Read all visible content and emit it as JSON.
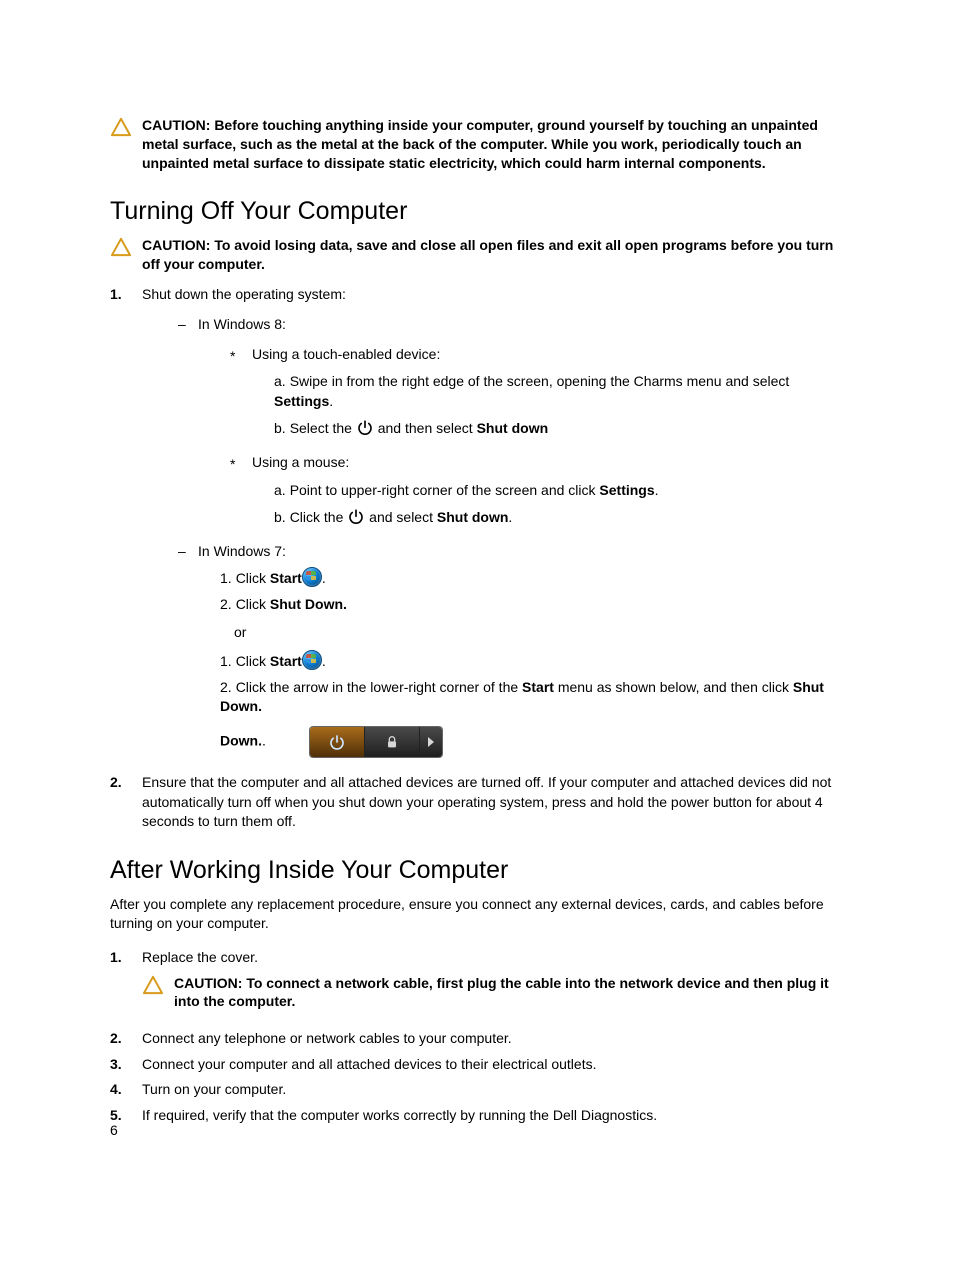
{
  "caution1": "CAUTION: Before touching anything inside your computer, ground yourself by touching an unpainted metal surface, such as the metal at the back of the computer. While you work, periodically touch an unpainted metal surface to dissipate static electricity, which could harm internal components.",
  "heading1": "Turning Off Your Computer",
  "caution2": "CAUTION: To avoid losing data, save and close all open files and exit all open programs before you turn off your computer.",
  "step1": "Shut down the operating system:",
  "win8_label": "In Windows 8:",
  "touch_label": "Using a touch-enabled device:",
  "touch_a_pre": "Swipe in from the right edge of the screen, opening the Charms menu and select ",
  "touch_a_bold": "Settings",
  "touch_a_post": ".",
  "touch_b_pre": "Select the ",
  "touch_b_mid": " and then select ",
  "touch_b_bold": "Shut down",
  "mouse_label": "Using a mouse:",
  "mouse_a_pre": "Point to upper-right corner of the screen and click ",
  "mouse_a_bold": "Settings",
  "mouse_a_post": ".",
  "mouse_b_pre": "Click the ",
  "mouse_b_mid": " and select ",
  "mouse_b_bold": "Shut down",
  "mouse_b_post": ".",
  "win7_label": "In Windows 7:",
  "w7_1_pre": "Click ",
  "w7_1_bold": "Start",
  "w7_1_post": ".",
  "w7_2_pre": "Click ",
  "w7_2_bold": "Shut Down.",
  "or_text": "or",
  "w7b_1_pre": "Click ",
  "w7b_1_bold": "Start",
  "w7b_1_post": ".",
  "w7b_2_pre": "Click the arrow in the lower-right corner of the ",
  "w7b_2_bold1": "Start",
  "w7b_2_mid": " menu as shown below, and then click ",
  "w7b_2_bold2": "Shut Down.",
  "w7b_2_post": ".",
  "step2": "Ensure that the computer and all attached devices are turned off. If your computer and attached devices did not automatically turn off when you shut down your operating system, press and hold the power button for about 4 seconds to turn them off.",
  "heading2": "After Working Inside Your Computer",
  "after_intro": "After you complete any replacement procedure, ensure you connect any external devices, cards, and cables before turning on your computer.",
  "a_step1": "Replace the cover.",
  "caution3": "CAUTION: To connect a network cable, first plug the cable into the network device and then plug it into the computer.",
  "a_step2": "Connect any telephone or network cables to your computer.",
  "a_step3": "Connect your computer and all attached devices to their electrical outlets.",
  "a_step4": "Turn on your computer.",
  "a_step5": "If required, verify that the computer works correctly by running the Dell Diagnostics.",
  "page_number": "6",
  "markers": {
    "n1": "1.",
    "n2": "2.",
    "n3": "3.",
    "n4": "4.",
    "n5": "5.",
    "la": "a.",
    "lb": "b.",
    "i1": "1.",
    "i2": "2."
  }
}
